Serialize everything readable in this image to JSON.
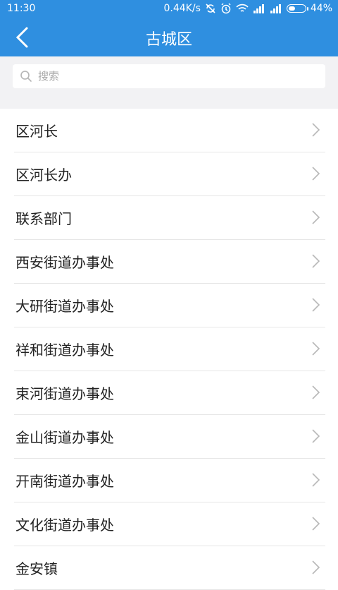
{
  "status_bar": {
    "time": "11:30",
    "network_speed": "0.44K/s",
    "battery_percent": "44%",
    "battery_level": 0.44
  },
  "header": {
    "title": "古城区",
    "background_color": "#2f8fe0"
  },
  "search": {
    "placeholder": "搜索"
  },
  "list": {
    "items": [
      {
        "label": "区河长"
      },
      {
        "label": "区河长办"
      },
      {
        "label": "联系部门"
      },
      {
        "label": "西安街道办事处"
      },
      {
        "label": "大研街道办事处"
      },
      {
        "label": "祥和街道办事处"
      },
      {
        "label": "束河街道办事处"
      },
      {
        "label": "金山街道办事处"
      },
      {
        "label": "开南街道办事处"
      },
      {
        "label": "文化街道办事处"
      },
      {
        "label": "金安镇"
      }
    ]
  }
}
